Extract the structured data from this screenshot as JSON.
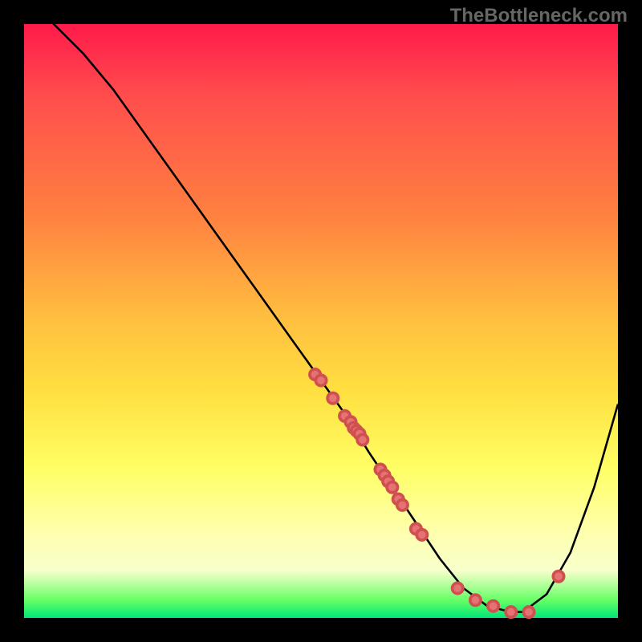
{
  "watermark": "TheBottleneck.com",
  "chart_data": {
    "type": "line",
    "title": "",
    "xlabel": "",
    "ylabel": "",
    "xlim": [
      0,
      100
    ],
    "ylim": [
      0,
      100
    ],
    "curve": {
      "x": [
        0,
        5,
        10,
        15,
        20,
        25,
        30,
        35,
        40,
        45,
        50,
        55,
        58,
        62,
        66,
        70,
        74,
        78,
        82,
        84,
        88,
        92,
        96,
        100
      ],
      "y": [
        105,
        100,
        95,
        89,
        82,
        75,
        68,
        61,
        54,
        47,
        40,
        33,
        28,
        22,
        16,
        10,
        5,
        2,
        1,
        1,
        4,
        11,
        22,
        36
      ]
    },
    "points": {
      "x": [
        49,
        50,
        52,
        54,
        55,
        55.5,
        56,
        56.5,
        57,
        60,
        60.7,
        61.3,
        62,
        63,
        63.7,
        66,
        67,
        73,
        76,
        79,
        82,
        85,
        90
      ],
      "y": [
        41,
        40,
        37,
        34,
        33,
        32,
        31.5,
        31,
        30,
        25,
        24,
        23,
        22,
        20,
        19,
        15,
        14,
        5,
        3,
        2,
        1,
        1,
        7
      ]
    }
  }
}
